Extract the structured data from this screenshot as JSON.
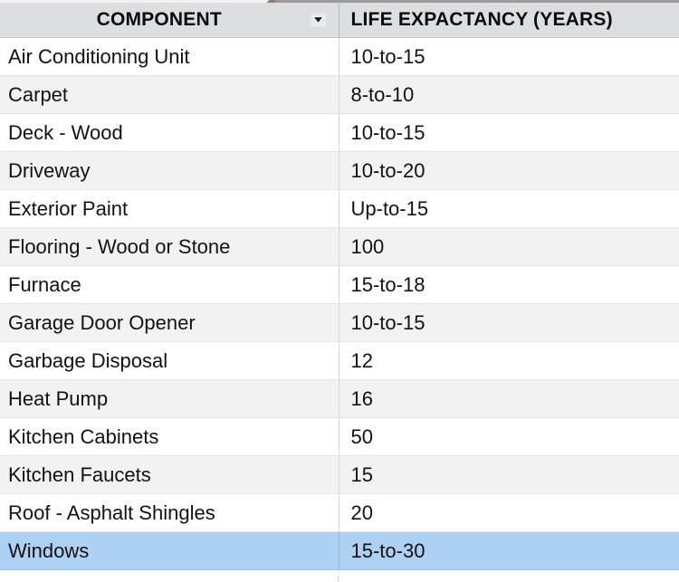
{
  "table": {
    "columns": [
      {
        "key": "component",
        "label": "COMPONENT",
        "has_filter": true,
        "filter_icon": "chevron-down-icon"
      },
      {
        "key": "life",
        "label": "LIFE EXPACTANCY (YEARS)",
        "has_filter": false
      }
    ],
    "selected_row_index": 13,
    "colors": {
      "header_background": "#dcdee2",
      "header_text": "#0b0b0b",
      "row_odd_background": "#ffffff",
      "row_even_background": "#f2f2f2",
      "selected_row_background": "#aed0f2",
      "cell_text": "#121212",
      "grid_line": "#d5d7da"
    },
    "rows": [
      {
        "component": "Air Conditioning Unit",
        "life": "10-to-15"
      },
      {
        "component": "Carpet",
        "life": "8-to-10"
      },
      {
        "component": "Deck - Wood",
        "life": "10-to-15"
      },
      {
        "component": "Driveway",
        "life": "10-to-20"
      },
      {
        "component": "Exterior Paint",
        "life": "Up-to-15"
      },
      {
        "component": "Flooring - Wood or Stone",
        "life": "100"
      },
      {
        "component": "Furnace",
        "life": "15-to-18"
      },
      {
        "component": "Garage Door Opener",
        "life": "10-to-15"
      },
      {
        "component": "Garbage Disposal",
        "life": "12"
      },
      {
        "component": "Heat Pump",
        "life": "16"
      },
      {
        "component": "Kitchen Cabinets",
        "life": "50"
      },
      {
        "component": "Kitchen Faucets",
        "life": "15"
      },
      {
        "component": "Roof - Asphalt Shingles",
        "life": "20"
      },
      {
        "component": "Windows",
        "life": "15-to-30"
      }
    ]
  }
}
